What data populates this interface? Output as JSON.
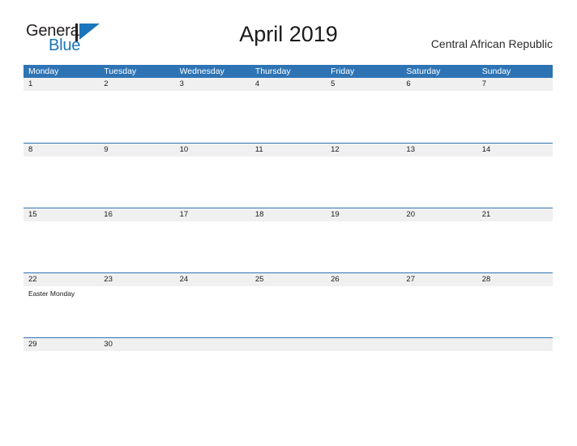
{
  "brand": {
    "name_part1": "General",
    "name_part2": "Blue",
    "mark_icon": "triangle-sail-icon",
    "color_dark": "#231f20",
    "color_blue": "#1b75bb"
  },
  "header": {
    "title": "April 2019",
    "country": "Central African Republic"
  },
  "theme": {
    "header_blue": "#2e74b5",
    "date_band_gray": "#f0f0f0",
    "text_dark": "#1a1a1a",
    "background": "#ffffff"
  },
  "calendar": {
    "month": "April",
    "year": "2019",
    "weekday_headers": [
      "Monday",
      "Tuesday",
      "Wednesday",
      "Thursday",
      "Friday",
      "Saturday",
      "Sunday"
    ],
    "weeks": [
      {
        "days": [
          {
            "date": "1",
            "events": []
          },
          {
            "date": "2",
            "events": []
          },
          {
            "date": "3",
            "events": []
          },
          {
            "date": "4",
            "events": []
          },
          {
            "date": "5",
            "events": []
          },
          {
            "date": "6",
            "events": []
          },
          {
            "date": "7",
            "events": []
          }
        ]
      },
      {
        "days": [
          {
            "date": "8",
            "events": []
          },
          {
            "date": "9",
            "events": []
          },
          {
            "date": "10",
            "events": []
          },
          {
            "date": "11",
            "events": []
          },
          {
            "date": "12",
            "events": []
          },
          {
            "date": "13",
            "events": []
          },
          {
            "date": "14",
            "events": []
          }
        ]
      },
      {
        "days": [
          {
            "date": "15",
            "events": []
          },
          {
            "date": "16",
            "events": []
          },
          {
            "date": "17",
            "events": []
          },
          {
            "date": "18",
            "events": []
          },
          {
            "date": "19",
            "events": []
          },
          {
            "date": "20",
            "events": []
          },
          {
            "date": "21",
            "events": []
          }
        ]
      },
      {
        "days": [
          {
            "date": "22",
            "events": [
              "Easter Monday"
            ]
          },
          {
            "date": "23",
            "events": []
          },
          {
            "date": "24",
            "events": []
          },
          {
            "date": "25",
            "events": []
          },
          {
            "date": "26",
            "events": []
          },
          {
            "date": "27",
            "events": []
          },
          {
            "date": "28",
            "events": []
          }
        ]
      },
      {
        "days": [
          {
            "date": "29",
            "events": []
          },
          {
            "date": "30",
            "events": []
          },
          {
            "date": "",
            "events": []
          },
          {
            "date": "",
            "events": []
          },
          {
            "date": "",
            "events": []
          },
          {
            "date": "",
            "events": []
          },
          {
            "date": "",
            "events": []
          }
        ]
      }
    ]
  }
}
